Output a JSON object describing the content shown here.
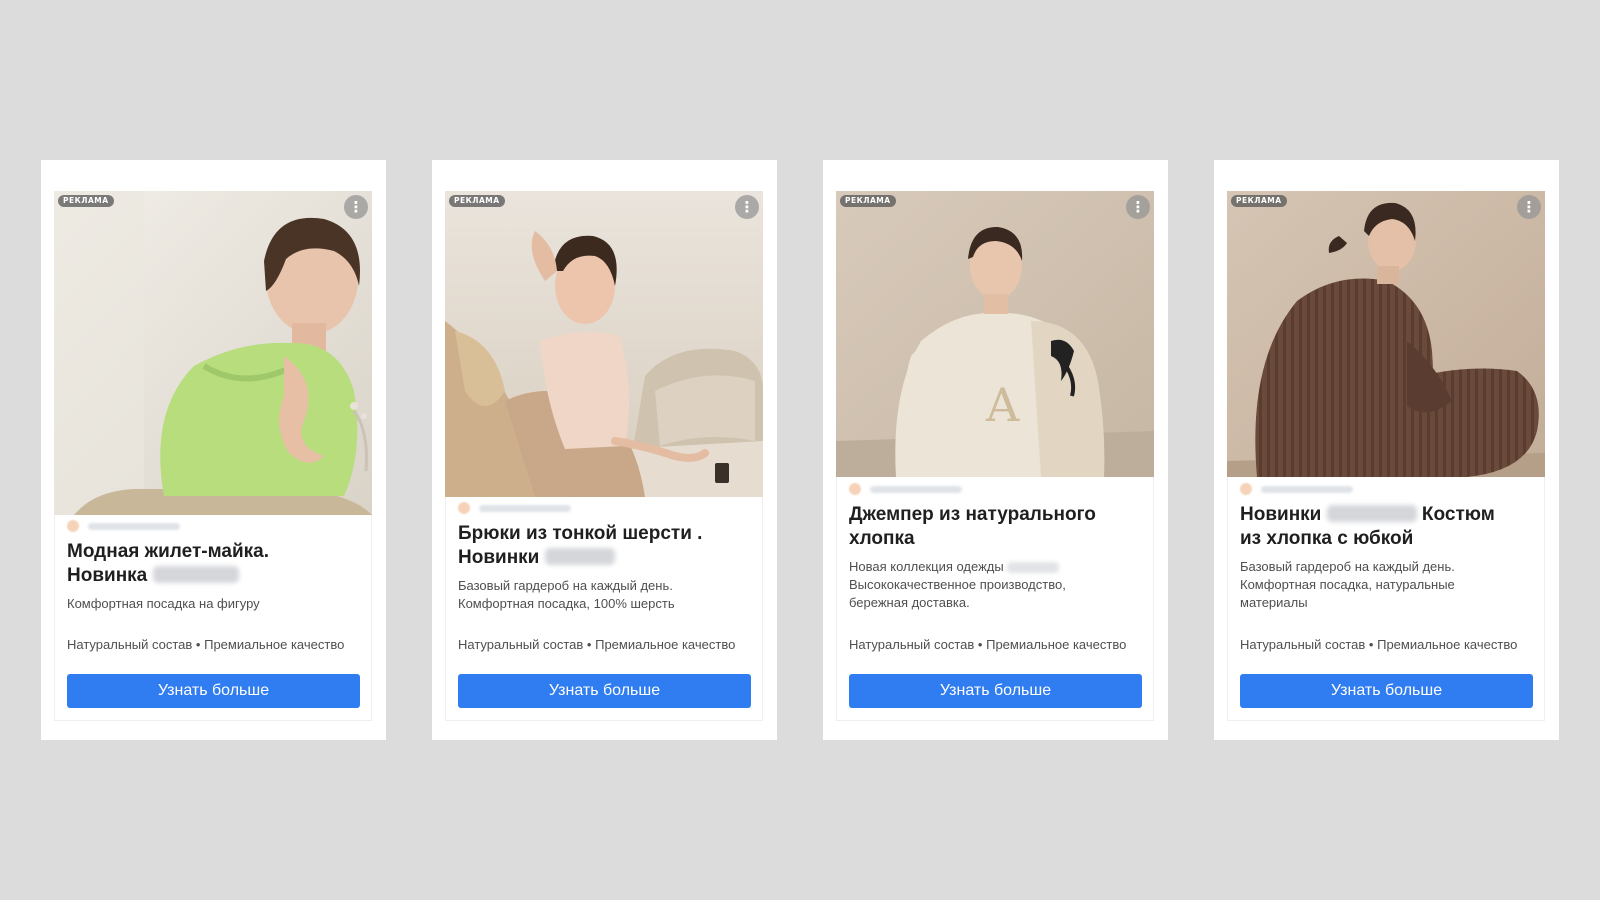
{
  "background_color": "#dcdcdc",
  "accent_color": "#2f7df0",
  "ad_label": "РЕКЛАМА",
  "menu_icon": "vertical-dots-icon",
  "menu_glyph": "⋮",
  "cards": [
    {
      "image": "Фото: девушка в зелёном вязаном жилете",
      "title_line1": "Модная жилет-майка.",
      "title_line2": "Новинка",
      "desc_line1": "Комфортная посадка на фигуру",
      "desc_line2": "",
      "desc_line3": "",
      "features": "Натуральный состав • Премиальное качество",
      "cta_label": "Узнать больше"
    },
    {
      "image": "Фото: девушка в бежевом костюме на диване",
      "title_line1": "Брюки из тонкой шерсти .",
      "title_line2": "Новинки",
      "desc_line1": "Базовый гардероб на каждый день.",
      "desc_line2": "Комфортная посадка, 100% шерсть",
      "desc_line3": "",
      "features": "Натуральный состав • Премиальное качество",
      "cta_label": "Узнать больше"
    },
    {
      "image": "Фото: девушка в светлом джемпере",
      "title_line1": "Джемпер из натурального",
      "title_line2": "хлопка",
      "desc_line1": "Новая коллекция одежды",
      "desc_line2": "Высококачественное производство,",
      "desc_line3": "бережная доставка.",
      "features": "Натуральный состав • Премиальное качество",
      "cta_label": "Узнать больше"
    },
    {
      "image": "Фото: девушка в коричневом трикотажном костюме",
      "title_line1a": "Новинки",
      "title_line1b": "Костюм",
      "title_line2": "из хлопка с юбкой",
      "desc_line1": "Базовый гардероб на каждый день.",
      "desc_line2": "Комфортная посадка, натуральные",
      "desc_line3": "материалы",
      "features": "Натуральный состав • Премиальное качество",
      "cta_label": "Узнать больше"
    }
  ]
}
